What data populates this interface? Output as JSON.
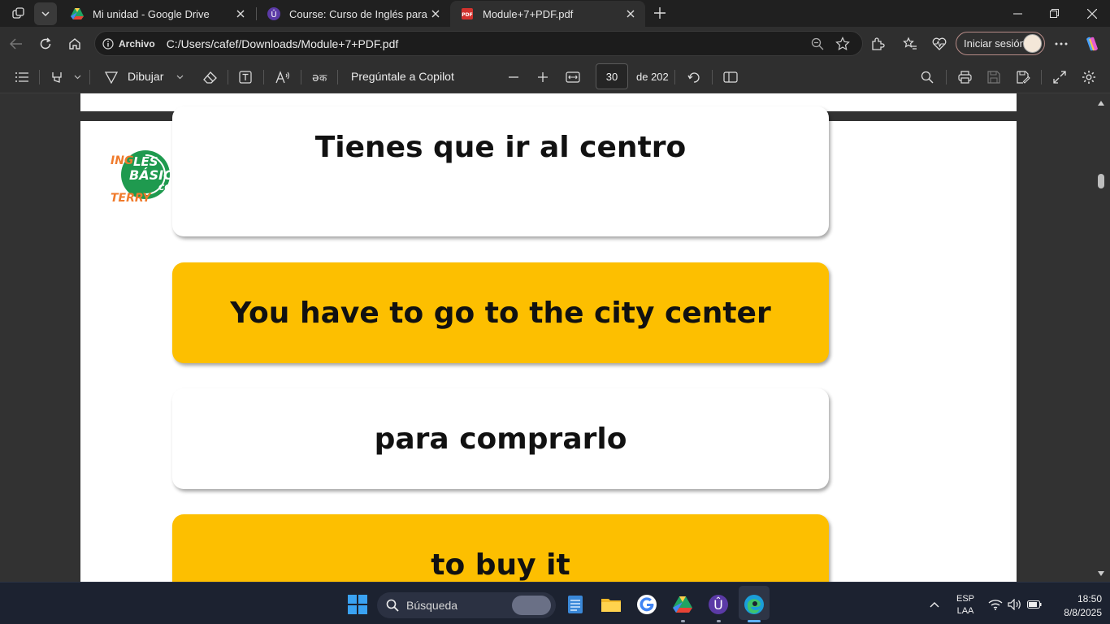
{
  "tabs": [
    {
      "title": "Mi unidad - Google Drive",
      "favicon": "google-drive-icon"
    },
    {
      "title": "Course: Curso de Inglés para principiantes",
      "favicon": "course-icon"
    },
    {
      "title": "Module+7+PDF.pdf",
      "favicon": "pdf-icon",
      "active": true
    }
  ],
  "address": {
    "label": "Archivo",
    "url": "C:/Users/cafef/Downloads/Module+7+PDF.pdf"
  },
  "profile": {
    "signin_label": "Iniciar sesión"
  },
  "pdf_toolbar": {
    "draw_label": "Dibujar",
    "copilot_label": "Pregúntale a Copilot",
    "current_page": "30",
    "page_total": "de 202"
  },
  "document": {
    "logo_text": {
      "line1": "INGLÉS",
      "line2": "BÁSICO",
      "line3": "CON",
      "line4": "TERRY"
    },
    "cards": [
      {
        "text": "Tienes que ir al centro",
        "style": "white"
      },
      {
        "text": "You have to go to the city center",
        "style": "yellow"
      },
      {
        "text": "para comprarlo",
        "style": "white"
      },
      {
        "text": "to buy it",
        "style": "yellow"
      }
    ]
  },
  "taskbar": {
    "search_placeholder": "Búsqueda",
    "language": "ESP",
    "layout": "LAA",
    "time": "18:50",
    "date": "8/8/2025"
  },
  "colors": {
    "card_yellow": "#fdbf00",
    "logo_green": "#1f9a4f",
    "logo_orange": "#f07b2c"
  }
}
